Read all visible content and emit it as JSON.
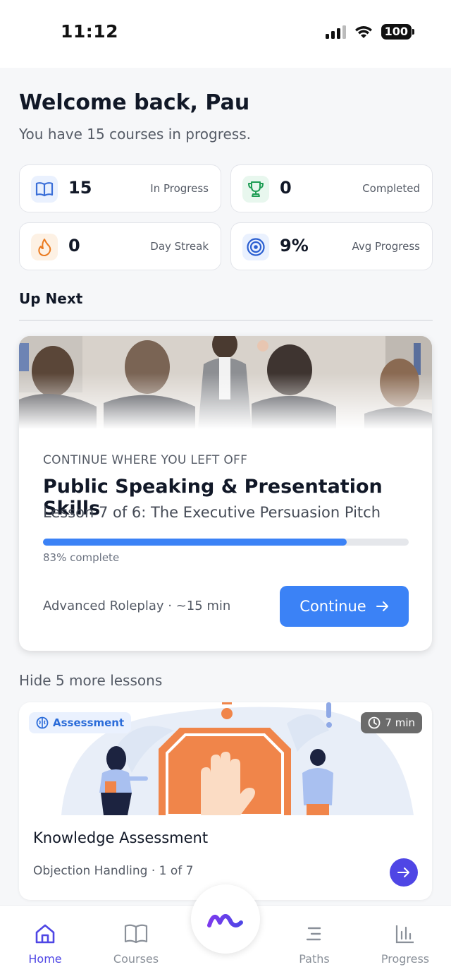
{
  "status_bar": {
    "time": "11:12",
    "battery": "100"
  },
  "header": {
    "welcome": "Welcome back, Pau",
    "subtitle": "You have 15 courses in progress."
  },
  "stats": [
    {
      "value": "15",
      "label": "In Progress",
      "icon": "book-icon"
    },
    {
      "value": "0",
      "label": "Completed",
      "icon": "trophy-icon"
    },
    {
      "value": "0",
      "label": "Day Streak",
      "icon": "flame-icon"
    },
    {
      "value": "9%",
      "label": "Avg Progress",
      "icon": "target-icon"
    }
  ],
  "up_next": {
    "section_title": "Up Next",
    "eyebrow": "CONTINUE WHERE YOU LEFT OFF",
    "course_title": "Public Speaking & Presentation Skills",
    "lesson": "Lesson 7 of 6: The Executive Persuasion Pitch",
    "progress_percent": 83,
    "progress_text": "83% complete",
    "meta": "Advanced Roleplay · ~15 min",
    "button_label": "Continue"
  },
  "more_lessons": {
    "toggle_label": "Hide 5 more lessons",
    "items": [
      {
        "badge": "Assessment",
        "duration": "7 min",
        "title": "Knowledge Assessment",
        "meta": "Objection Handling · 1 of 7"
      }
    ]
  },
  "nav": {
    "items": [
      {
        "label": "Home",
        "active": true
      },
      {
        "label": "Courses",
        "active": false
      },
      {
        "label": "Paths",
        "active": false
      },
      {
        "label": "Progress",
        "active": false
      }
    ]
  },
  "colors": {
    "primary": "#3b82f6",
    "accent": "#4f46e5",
    "orange": "#f0854a"
  }
}
